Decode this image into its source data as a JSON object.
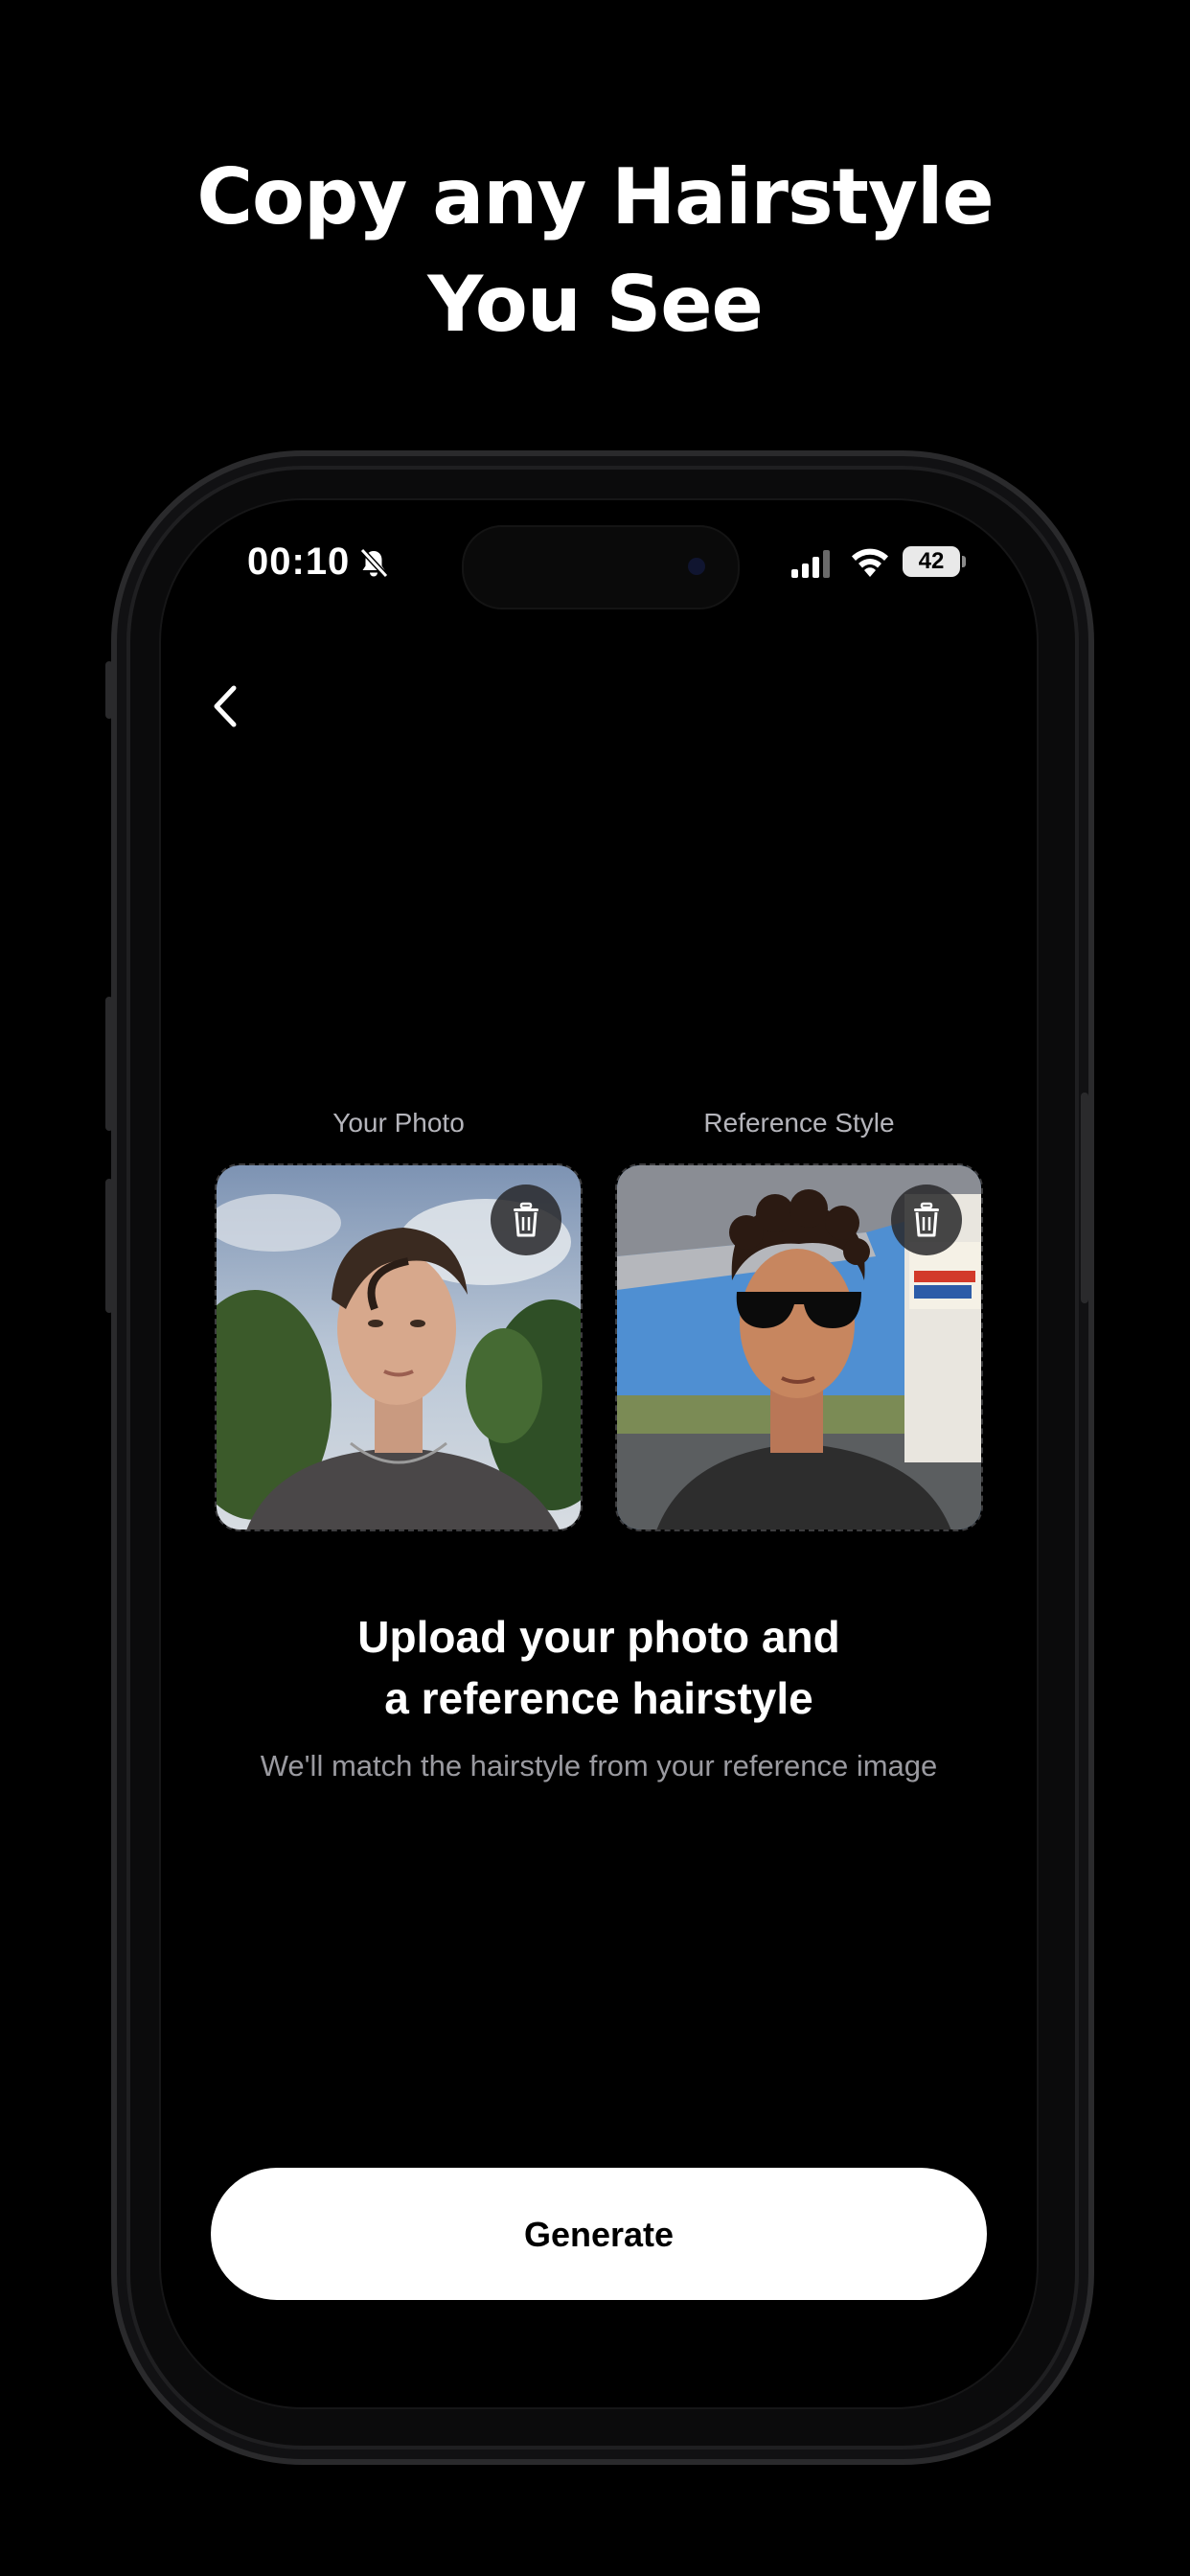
{
  "headline": {
    "line1": "Copy any Hairstyle",
    "line2": "You See"
  },
  "status_bar": {
    "time": "00:10",
    "battery": "42",
    "icons": [
      "bell-slash-icon",
      "cellular-signal-icon",
      "wifi-icon",
      "battery-icon"
    ]
  },
  "nav": {
    "back_icon": "chevron-left-icon"
  },
  "upload": {
    "your_photo_label": "Your Photo",
    "reference_label": "Reference Style",
    "delete_icon": "trash-icon"
  },
  "content": {
    "heading_line1": "Upload your photo and",
    "heading_line2": "a reference hairstyle",
    "subtext": "We'll match the hairstyle from your reference image"
  },
  "actions": {
    "generate_label": "Generate"
  },
  "colors": {
    "background": "#000000",
    "button_bg": "#ffffff",
    "muted_text": "#9a9aa0"
  }
}
